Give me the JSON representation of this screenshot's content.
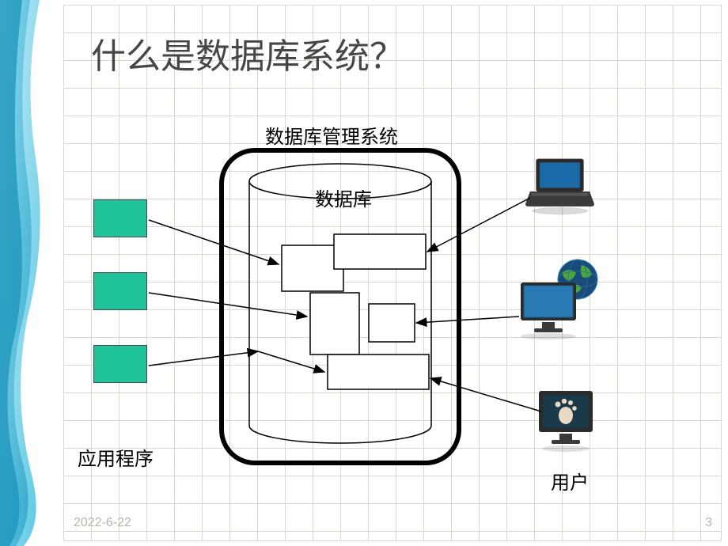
{
  "title": "什么是数据库系统？",
  "labels": {
    "dbms": "数据库管理系统",
    "database": "数据库",
    "applications": "应用程序",
    "users": "用户"
  },
  "footer": {
    "date": "2022-6-22",
    "page": "3"
  },
  "colors": {
    "green_box": "#1fc299",
    "grid_line": "#d8d8ca",
    "title_text": "#464646",
    "footer_text": "#b5b5a9"
  },
  "diagram": {
    "application_boxes": 3,
    "user_devices": [
      "laptop",
      "globe-monitor",
      "desktop"
    ],
    "inner_tables": 5
  }
}
